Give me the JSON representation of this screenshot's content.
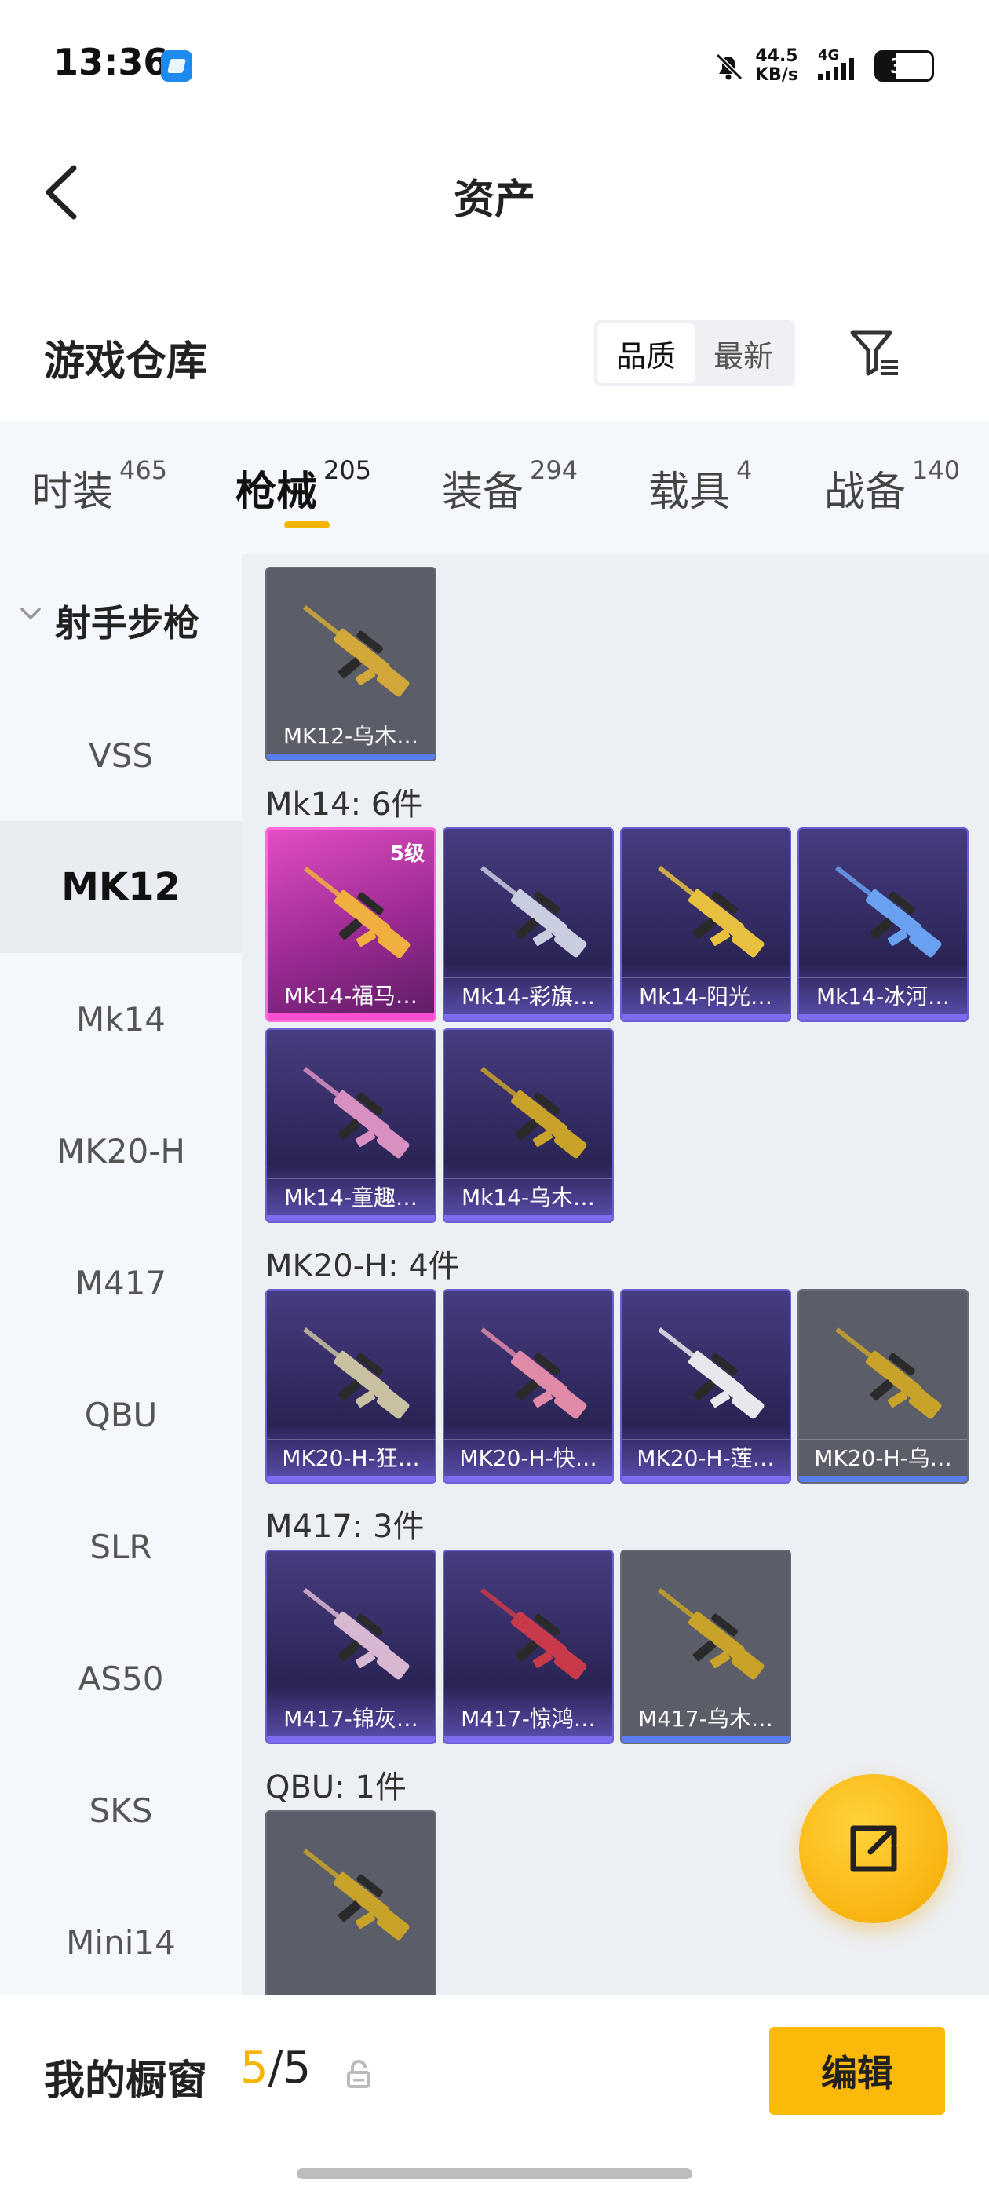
{
  "status": {
    "time": "13:36",
    "speed_value": "44.5",
    "speed_unit": "KB/s",
    "network": "4G",
    "battery": "36",
    "battery_level_percent": 36
  },
  "header": {
    "title": "资产"
  },
  "warehouse": {
    "title": "游戏仓库",
    "sort_options": [
      "品质",
      "最新"
    ],
    "sort_selected": "品质"
  },
  "tabs": [
    {
      "label": "时装",
      "count": "465"
    },
    {
      "label": "枪械",
      "count": "205",
      "active": true
    },
    {
      "label": "装备",
      "count": "294"
    },
    {
      "label": "载具",
      "count": "4"
    },
    {
      "label": "战备",
      "count": "140"
    }
  ],
  "sidebar": {
    "group": "射手步枪",
    "items": [
      "VSS",
      "MK12",
      "Mk14",
      "MK20-H",
      "M417",
      "QBU",
      "SLR",
      "AS50",
      "SKS",
      "Mini14"
    ],
    "active": "MK12"
  },
  "sections": [
    {
      "title": "",
      "items": [
        {
          "name": "MK12-乌木…",
          "tier": "gray",
          "gun": "#d2a83a"
        }
      ]
    },
    {
      "title": "Mk14: 6件",
      "items": [
        {
          "name": "Mk14-福马…",
          "tier": "pink",
          "level": "5级",
          "gun": "#f0b040"
        },
        {
          "name": "Mk14-彩旗…",
          "tier": "purple",
          "gun": "#c8cde0"
        },
        {
          "name": "Mk14-阳光…",
          "tier": "purple",
          "gun": "#e8c040"
        },
        {
          "name": "Mk14-冰河…",
          "tier": "purple",
          "gun": "#6aa0f0"
        },
        {
          "name": "Mk14-童趣…",
          "tier": "purple",
          "gun": "#d890c0"
        },
        {
          "name": "Mk14-乌木…",
          "tier": "purple",
          "gun": "#c9a22a"
        }
      ]
    },
    {
      "title": "MK20-H: 4件",
      "items": [
        {
          "name": "MK20-H-狂…",
          "tier": "purple",
          "gun": "#c8c0a0"
        },
        {
          "name": "MK20-H-快…",
          "tier": "purple",
          "gun": "#e08aa8"
        },
        {
          "name": "MK20-H-莲…",
          "tier": "purple",
          "gun": "#e8e8ec"
        },
        {
          "name": "MK20-H-乌…",
          "tier": "gray",
          "gun": "#c9a22a"
        }
      ]
    },
    {
      "title": "M417: 3件",
      "items": [
        {
          "name": "M417-锦灰…",
          "tier": "purple",
          "gun": "#d8b8d0"
        },
        {
          "name": "M417-惊鸿…",
          "tier": "purple",
          "gun": "#c83a4a"
        },
        {
          "name": "M417-乌木…",
          "tier": "gray",
          "gun": "#c9a22a"
        }
      ]
    },
    {
      "title": "QBU: 1件",
      "items": [
        {
          "name": "",
          "tier": "gray",
          "gun": "#c9a22a"
        }
      ]
    }
  ],
  "showcase": {
    "title": "我的橱窗",
    "current": "5",
    "separator": "/",
    "total": "5",
    "edit_label": "编辑"
  },
  "colors": {
    "accent": "#f5b400",
    "rare_purple": "#6c5fd0",
    "legend_pink": "#ff4fd0"
  }
}
